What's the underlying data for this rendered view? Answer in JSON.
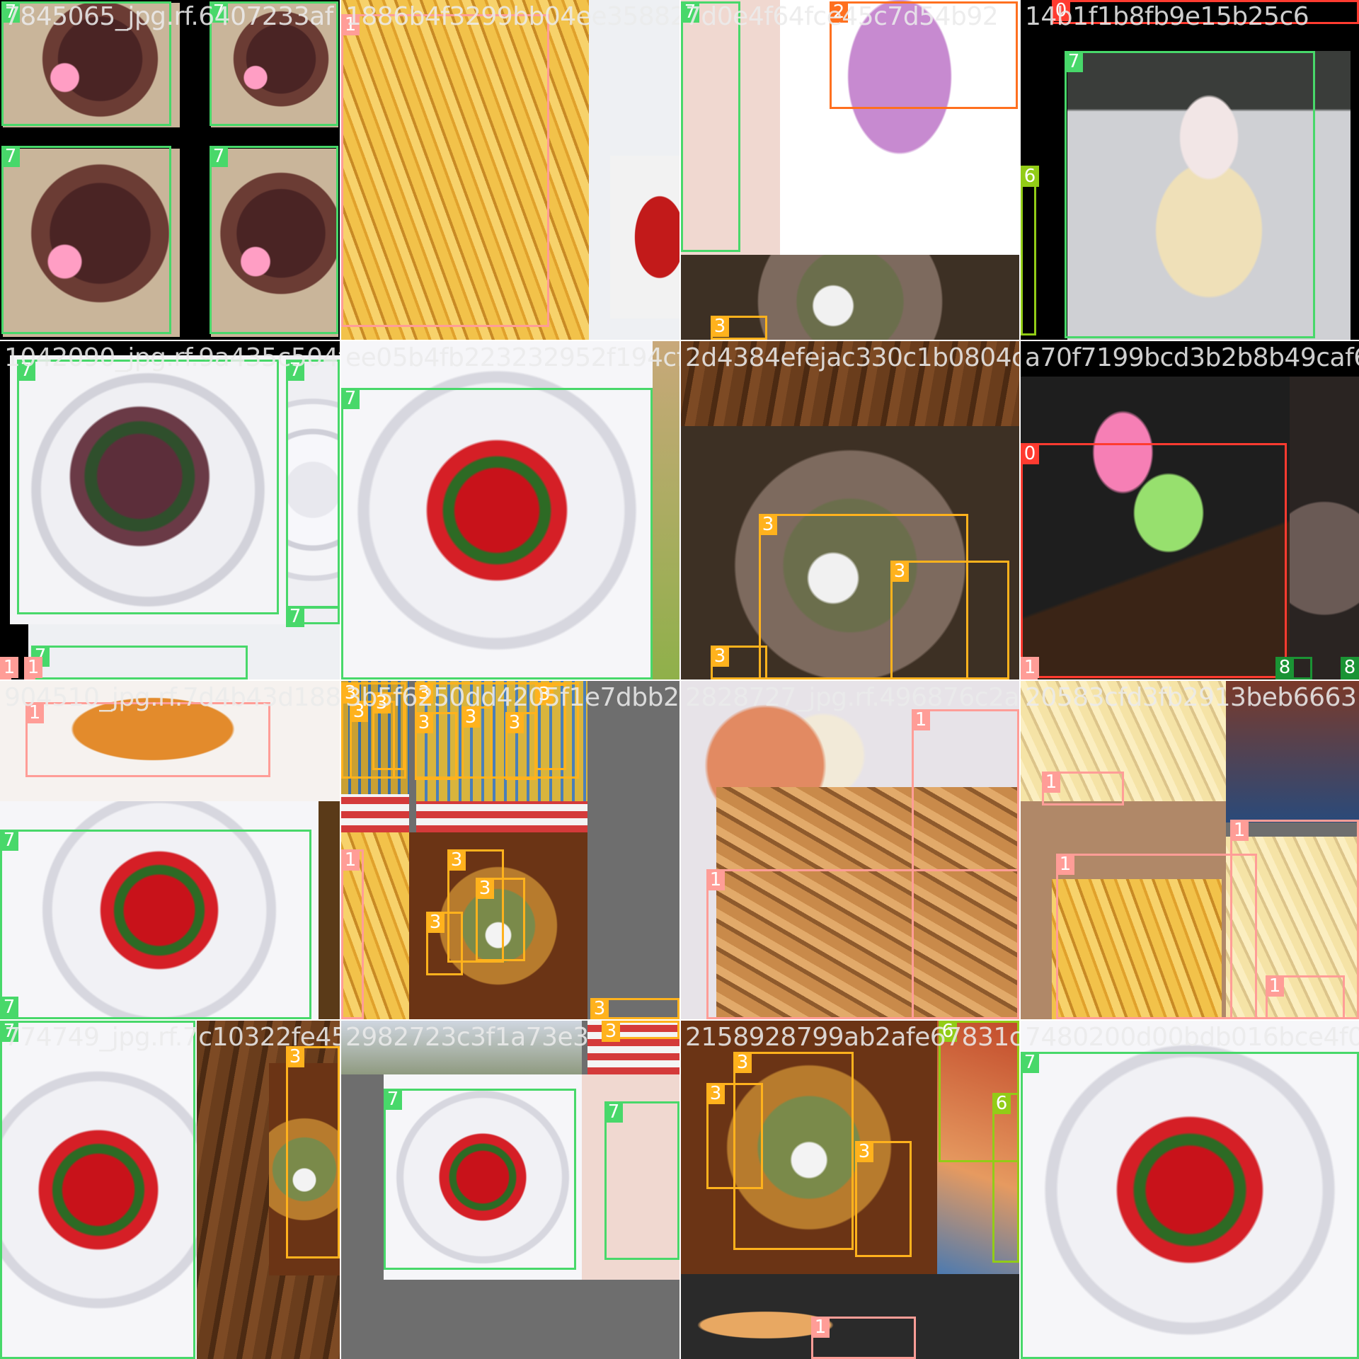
{
  "title": "",
  "class_colors": {
    "0": "#ff3b30",
    "1": "#ff9d97",
    "2": "#ff701f",
    "3": "#ffb21d",
    "6": "#92cc17",
    "7": "#48d86a",
    "8": "#1a9334"
  },
  "tiles": [
    {
      "name": "tile-r1-c1",
      "filename": "7845065_jpg.rf.6407233af",
      "boxes": [
        {
          "cls": "7"
        },
        {
          "cls": "7"
        },
        {
          "cls": "7"
        },
        {
          "cls": "7"
        }
      ]
    },
    {
      "name": "tile-r1-c2",
      "filename": "1886b4f3299bb04ee3588297",
      "boxes": [
        {
          "cls": "1"
        }
      ]
    },
    {
      "name": "tile-r1-c3",
      "filename": "7d0e4f64fce45c7d54b92",
      "boxes": [
        {
          "cls": "7"
        },
        {
          "cls": "2"
        },
        {
          "cls": "3"
        }
      ]
    },
    {
      "name": "tile-r1-c4",
      "filename": "14b1f1b8fb9e15b25c6",
      "boxes": [
        {
          "cls": "0"
        },
        {
          "cls": "7"
        },
        {
          "cls": "6"
        }
      ]
    },
    {
      "name": "tile-r2-c1",
      "filename": "1042090_jpg.rf.9a435c504fbe",
      "boxes": [
        {
          "cls": "7"
        },
        {
          "cls": "7"
        },
        {
          "cls": "7"
        },
        {
          "cls": "7"
        },
        {
          "cls": "1"
        },
        {
          "cls": "1"
        }
      ]
    },
    {
      "name": "tile-r2-c2",
      "filename": "ee05b4fb223232952f194cf6",
      "boxes": [
        {
          "cls": "7"
        }
      ]
    },
    {
      "name": "tile-r2-c3",
      "filename": "2d4384efejac330c1b0804c8",
      "boxes": [
        {
          "cls": "3"
        },
        {
          "cls": "3"
        },
        {
          "cls": "3"
        }
      ]
    },
    {
      "name": "tile-r2-c4",
      "filename": "a70f7199bcd3b2b8b49caf69",
      "boxes": [
        {
          "cls": "0"
        },
        {
          "cls": "1"
        },
        {
          "cls": "8"
        },
        {
          "cls": "8"
        }
      ]
    },
    {
      "name": "tile-r3-c1",
      "filename": "904510_jpg.rf.7d4b43d188f",
      "boxes": [
        {
          "cls": "1"
        },
        {
          "cls": "7"
        },
        {
          "cls": "7"
        }
      ]
    },
    {
      "name": "tile-r3-c2",
      "filename": "3b5f6250dd4205f1e7dbb2",
      "boxes": [
        {
          "cls": "3"
        },
        {
          "cls": "3"
        },
        {
          "cls": "3"
        },
        {
          "cls": "3"
        },
        {
          "cls": "3"
        },
        {
          "cls": "3"
        },
        {
          "cls": "3"
        },
        {
          "cls": "3"
        },
        {
          "cls": "1"
        },
        {
          "cls": "3"
        },
        {
          "cls": "3"
        },
        {
          "cls": "3"
        },
        {
          "cls": "3"
        }
      ]
    },
    {
      "name": "tile-r3-c3",
      "filename": "2828727_jpg.rf.496876c2a6",
      "boxes": [
        {
          "cls": "1"
        },
        {
          "cls": "1"
        }
      ]
    },
    {
      "name": "tile-r3-c4",
      "filename": "20583cfd3fb2913beb6663",
      "boxes": [
        {
          "cls": "1"
        },
        {
          "cls": "1"
        },
        {
          "cls": "1"
        },
        {
          "cls": "1"
        }
      ]
    },
    {
      "name": "tile-r4-c1",
      "filename": "774749_jpg.rf.7c10322fe45f",
      "boxes": [
        {
          "cls": "7"
        },
        {
          "cls": "3"
        }
      ]
    },
    {
      "name": "tile-r4-c2",
      "filename": "2982723c3f1a73e3",
      "boxes": [
        {
          "cls": "3"
        },
        {
          "cls": "7"
        },
        {
          "cls": "7"
        }
      ]
    },
    {
      "name": "tile-r4-c3",
      "filename": "2158928799ab2afe67831c2",
      "boxes": [
        {
          "cls": "3"
        },
        {
          "cls": "3"
        },
        {
          "cls": "3"
        },
        {
          "cls": "6"
        },
        {
          "cls": "6"
        },
        {
          "cls": "1"
        }
      ]
    },
    {
      "name": "tile-r4-c4",
      "filename": "7480200d00bdb016bce4f08",
      "boxes": [
        {
          "cls": "7"
        }
      ]
    }
  ]
}
